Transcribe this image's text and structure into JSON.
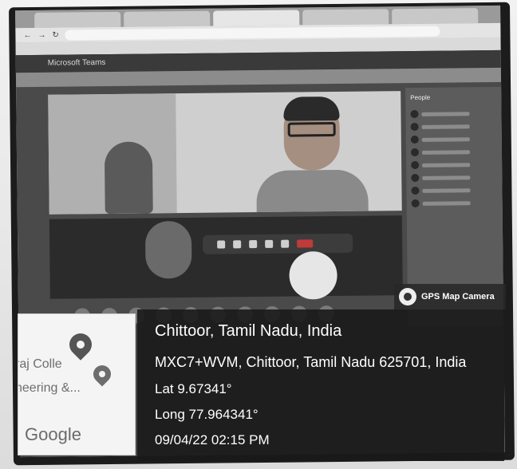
{
  "browser": {
    "tabs": [
      "",
      "",
      "",
      "",
      ""
    ],
    "url": "",
    "bookmarks": []
  },
  "teams": {
    "app_title": "Microsoft Teams",
    "recording_banner": "",
    "call_time": "",
    "people_title": "People",
    "participant_label": ""
  },
  "gps": {
    "badge_label": "GPS Map Camera",
    "location_title": "Chittoor, Tamil Nadu, India",
    "address": "MXC7+WVM, Chittoor, Tamil Nadu 625701, India",
    "latitude": "Lat 9.67341°",
    "longitude": "Long 77.964341°",
    "datetime": "09/04/22 02:15 PM"
  },
  "map_thumbnail": {
    "text_line1": "raj Colle",
    "text_line2": "neering &...",
    "logo": "Google"
  }
}
